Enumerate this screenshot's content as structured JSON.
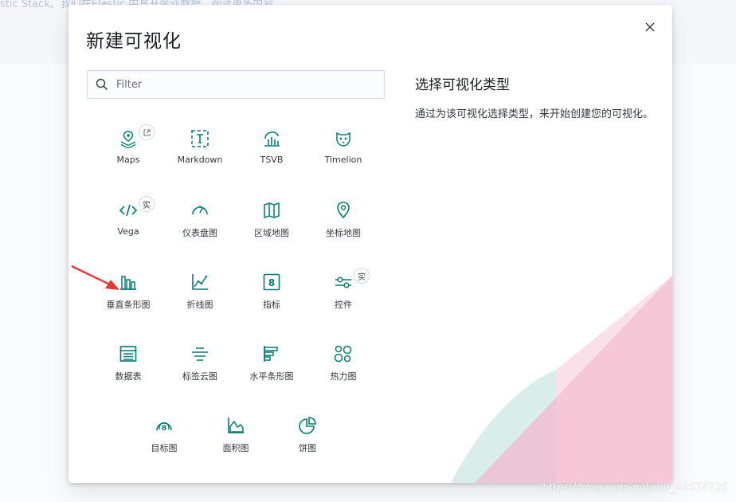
{
  "background": {
    "header_text": "stic Stack。我们在Elastic 中具开金业数据，阅读更多内容"
  },
  "modal": {
    "title": "新建可视化",
    "close_label": "×"
  },
  "search": {
    "placeholder": "Filter",
    "value": ""
  },
  "tiles": [
    {
      "label": "Maps",
      "icon": "maps-icon",
      "badge": "external-link-icon"
    },
    {
      "label": "Markdown",
      "icon": "markdown-icon"
    },
    {
      "label": "TSVB",
      "icon": "tsvb-icon"
    },
    {
      "label": "Timelion",
      "icon": "timelion-icon"
    },
    {
      "label": "Vega",
      "icon": "vega-icon",
      "badge": "实"
    },
    {
      "label": "仪表盘图",
      "icon": "gauge-icon"
    },
    {
      "label": "区域地图",
      "icon": "region-map-icon"
    },
    {
      "label": "坐标地图",
      "icon": "coordinate-map-icon"
    },
    {
      "label": "垂直条形图",
      "icon": "vertical-bar-icon"
    },
    {
      "label": "折线图",
      "icon": "line-chart-icon"
    },
    {
      "label": "指标",
      "icon": "metric-icon"
    },
    {
      "label": "控件",
      "icon": "controls-icon",
      "badge": "实"
    },
    {
      "label": "数据表",
      "icon": "data-table-icon"
    },
    {
      "label": "标签云图",
      "icon": "tag-cloud-icon"
    },
    {
      "label": "水平条形图",
      "icon": "horizontal-bar-icon"
    },
    {
      "label": "热力图",
      "icon": "heatmap-icon"
    },
    {
      "label": "目标图",
      "icon": "goal-icon"
    },
    {
      "label": "面积图",
      "icon": "area-chart-icon"
    },
    {
      "label": "饼图",
      "icon": "pie-chart-icon"
    }
  ],
  "description": {
    "title": "选择可视化类型",
    "text": "通过为该可视化选择类型，来开始创建您的可视化。"
  },
  "colors": {
    "accent": "#017d73",
    "pink": "#f0a8c0",
    "teal": "#a8d8d2"
  },
  "watermark": "https://blog.csdn.net/m0_46674735"
}
